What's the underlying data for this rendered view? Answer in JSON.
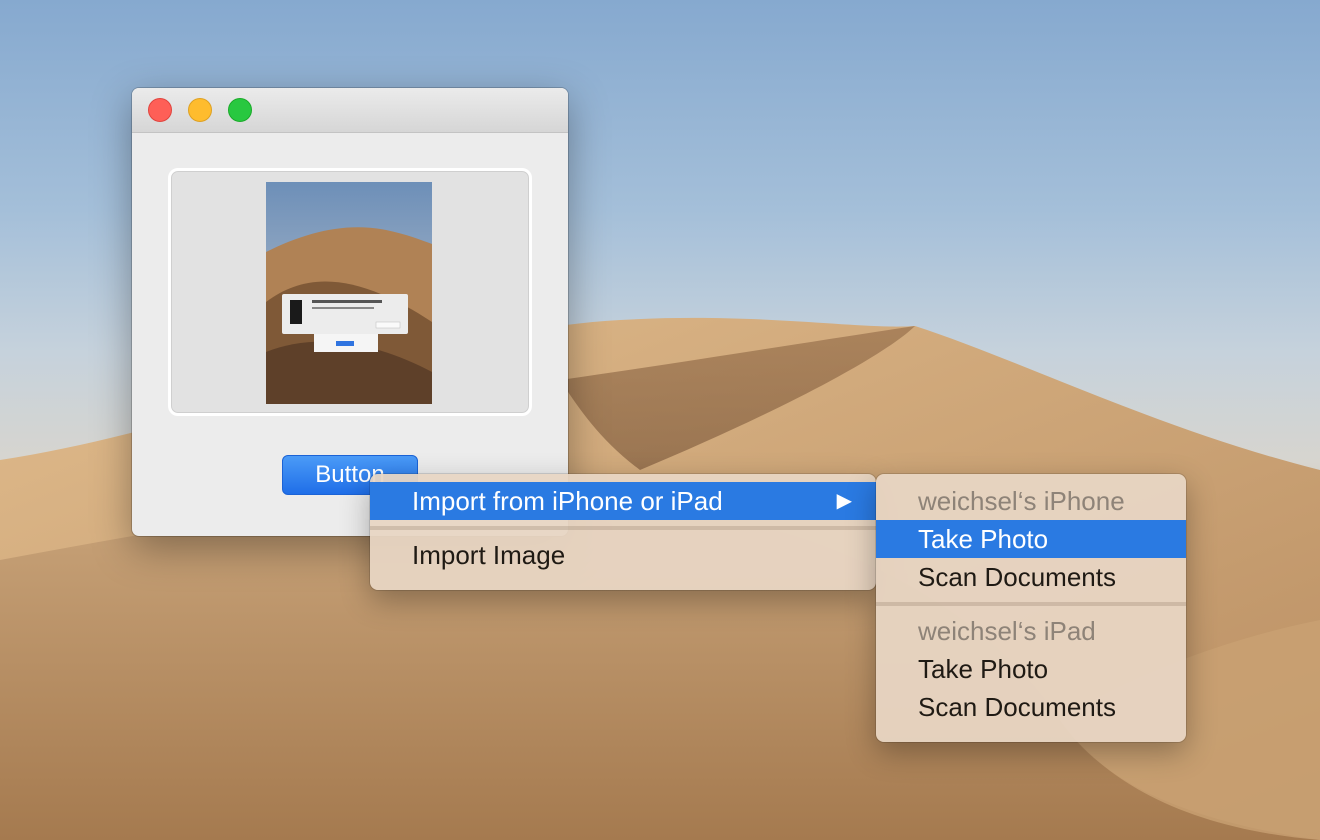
{
  "window": {
    "button_label": "Button"
  },
  "menu": {
    "items": [
      {
        "label": "Import from iPhone or iPad",
        "has_submenu": true,
        "highlighted": true
      },
      {
        "label": "Import Image",
        "has_submenu": false,
        "highlighted": false
      }
    ],
    "submenu_arrow": "▶"
  },
  "submenu": {
    "groups": [
      {
        "header": "weichsel‘s iPhone",
        "items": [
          "Take Photo",
          "Scan Documents"
        ]
      },
      {
        "header": "weichsel‘s iPad",
        "items": [
          "Take Photo",
          "Scan Documents"
        ]
      }
    ],
    "highlighted": "Take Photo"
  },
  "colors": {
    "highlight": "#2a7ae2",
    "close": "#fe5f57",
    "minimize": "#febc2e",
    "zoom": "#28c840"
  },
  "icons": {
    "submenu": "chevron-right-icon"
  }
}
